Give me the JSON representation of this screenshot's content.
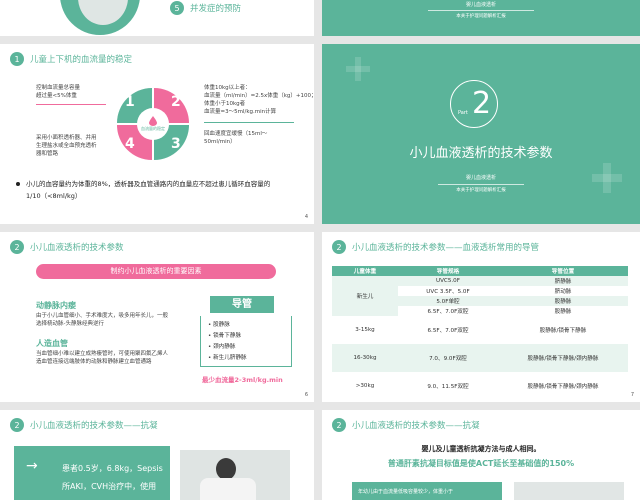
{
  "colors": {
    "teal": "#5bb49a",
    "pink": "#f06b9c",
    "page_bg": "#e6e6e6"
  },
  "s1": {
    "num": "5",
    "text": "并发症的预防"
  },
  "s2": {
    "title": "婴儿血液透析",
    "sub": "本关于护理问题解析汇报"
  },
  "s3": {
    "num": "1",
    "title": "儿童上下机的血流量的稳定",
    "left1": [
      "控制血流量总容量",
      "超过量<5%体重"
    ],
    "left2": [
      "采用小面积透析器、并用",
      "生理盐水或全血预充透析",
      "器和管路"
    ],
    "right1": [
      "体重10kg以上者：",
      "血流量（ml/min）=2.5x体重（kg）+100；",
      "体重小于10kg者",
      "血流量=3～5ml/kg.min计算"
    ],
    "right2": [
      "回血速度宜缓慢（15ml～",
      "50ml/min）"
    ],
    "center": "血流量的稳定",
    "quad": [
      "1",
      "2",
      "3",
      "4"
    ],
    "bullet": [
      "小儿的血容量约为体重的8%，透析器及血管通路内的血量应不超过患儿循环血容量的",
      "1/10（<8ml/kg）"
    ],
    "page": "4"
  },
  "s4": {
    "num": "2",
    "part": "Part",
    "title": "小儿血液透析的技术参数",
    "sub": "婴儿血液透析",
    "sub2": "本关于护理问题解析汇报"
  },
  "s5": {
    "num": "2",
    "title": "小儿血液透析的技术参数",
    "banner": "制约小儿血液透析的重要因素",
    "h1": "动静脉内瘘",
    "p1": [
      "由于小儿血管细小、手术难度大，吸多用年长儿，一般",
      "选择桡动脉-头静脉经典逆行"
    ],
    "h2": "人造血管",
    "p2": [
      "当血管细小难以建立成熟瘘管时，可使用聚四氟乙烯人",
      "造血管连接远端肢体的动脉和静脉建立血管通路"
    ],
    "box_title": "导管",
    "box_items": [
      "股静脉",
      "锁骨下静脉",
      "颈内静脉",
      "新生儿脐静脉"
    ],
    "min_flow": "最少血流量2-3ml/kg.min",
    "page": "6"
  },
  "s6": {
    "num": "2",
    "title": "小儿血液透析的技术参数——血液透析常用的导管",
    "headers": [
      "儿童体重",
      "导管规格",
      "导管位置"
    ],
    "newborn": "新生儿",
    "newborn_rows": [
      [
        "UVC5.0F",
        "脐静脉"
      ],
      [
        "UVC 3.5F、5.0F",
        "脐动脉"
      ],
      [
        "5.0F单腔",
        "股静脉"
      ],
      [
        "6.5F、7.0F双腔",
        "股静脉"
      ]
    ],
    "rows": [
      [
        "3-15kg",
        "6.5F、7.0F双腔",
        "股静脉/锁骨下静脉"
      ],
      [
        "16-30kg",
        "7.0、9.0F双腔",
        "股静脉/锁骨下静脉/颈内静脉"
      ],
      [
        ">30kg",
        "9.0、11.5F双腔",
        "股静脉/锁骨下静脉/颈内静脉"
      ]
    ],
    "page": "7"
  },
  "s7": {
    "num": "2",
    "title": "小儿血液透析的技术参数——抗凝",
    "arrow": "→",
    "lines": [
      "患者0.5岁，6.8kg，Sepsis",
      "所AKI，CVH治疗中，使用"
    ]
  },
  "s8": {
    "num": "2",
    "title": "小儿血液透析的技术参数——抗凝",
    "l1": "婴儿及儿童透析抗凝方法与成人相同。",
    "l2": "普通肝素抗凝目标值是使ACT延长至基础值的150%",
    "bar": "年幼儿由于血流量低吸容量较少，体重小于"
  }
}
